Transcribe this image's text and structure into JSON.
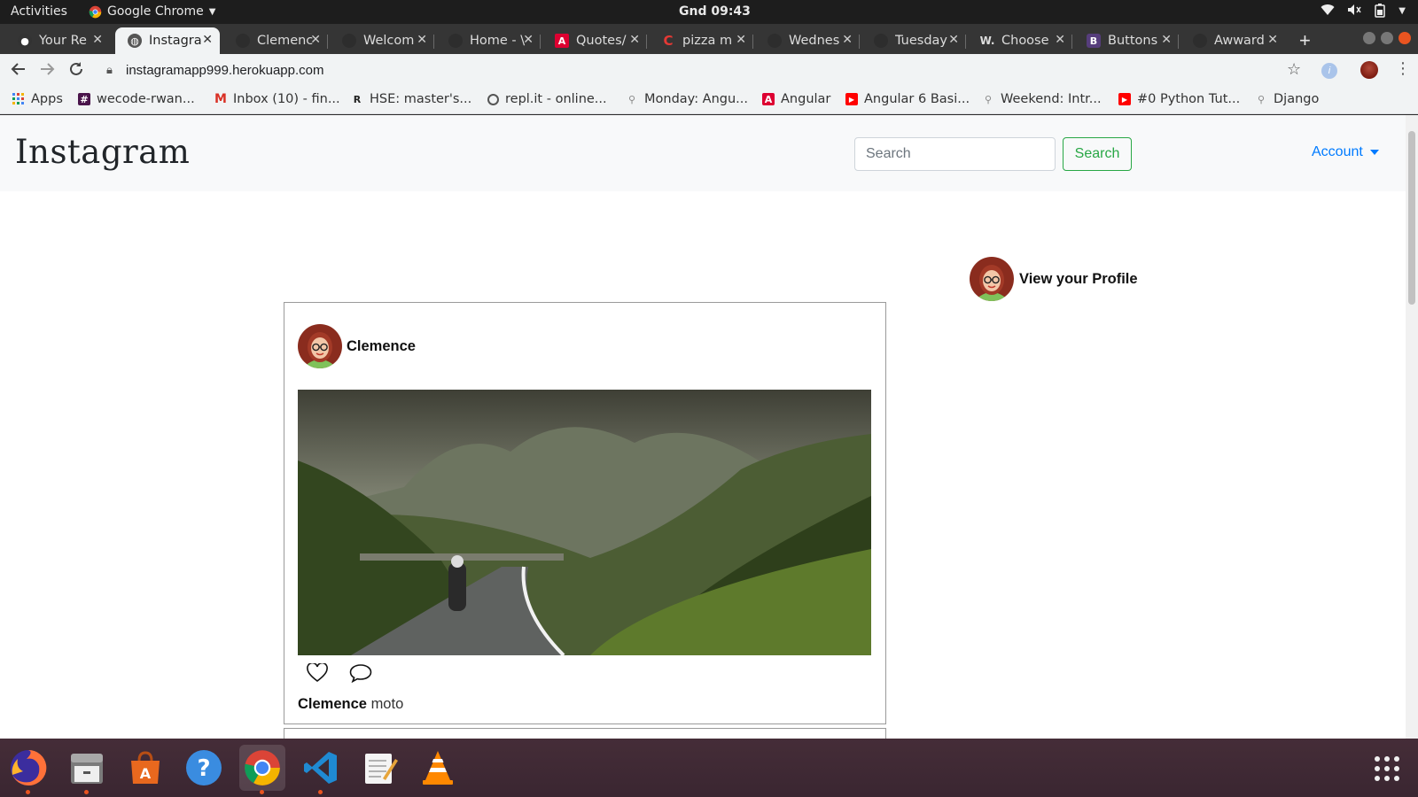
{
  "system": {
    "activities": "Activities",
    "app_name": "Google Chrome",
    "clock": "Gnd 09:43"
  },
  "tabs": [
    {
      "label": "Your Re",
      "icon": "github-icon",
      "color": "#333333"
    },
    {
      "label": "Instagra",
      "icon": "globe-icon",
      "color": "#555555",
      "active": true
    },
    {
      "label": "Clemenc",
      "icon": "github-icon",
      "color": "#333333"
    },
    {
      "label": "Welcom",
      "icon": "github-icon",
      "color": "#333333"
    },
    {
      "label": "Home - \\",
      "icon": "github-icon",
      "color": "#333333"
    },
    {
      "label": "Quotes/",
      "icon": "angular-icon",
      "color": "#dd0031"
    },
    {
      "label": "pizza m",
      "icon": "codepen-icon",
      "color": "#e53935"
    },
    {
      "label": "Wednes",
      "icon": "github-icon",
      "color": "#333333"
    },
    {
      "label": "Tuesday",
      "icon": "github-icon",
      "color": "#333333"
    },
    {
      "label": "Choose",
      "icon": "w3schools-icon",
      "color": "#222222"
    },
    {
      "label": "Buttons",
      "icon": "bootstrap-icon",
      "color": "#563d7c"
    },
    {
      "label": "Awward",
      "icon": "github-icon",
      "color": "#333333"
    }
  ],
  "address_bar": {
    "url": "instagramapp999.herokuapp.com"
  },
  "bookmarks": [
    {
      "label": "Apps",
      "icon": "apps-grid-icon",
      "color": "#4285f4"
    },
    {
      "label": "wecode-rwan...",
      "icon": "slack-icon",
      "color": "#4a154b"
    },
    {
      "label": "Inbox (10) - fin...",
      "icon": "gmail-icon",
      "color": "#d93025"
    },
    {
      "label": "HSE: master's...",
      "icon": "hse-icon",
      "color": "#222222"
    },
    {
      "label": "repl.it - online...",
      "icon": "replit-icon",
      "color": "#555555"
    },
    {
      "label": "Monday: Angu...",
      "icon": "pin-icon",
      "color": "#888888"
    },
    {
      "label": "Angular",
      "icon": "angular-icon",
      "color": "#dd0031"
    },
    {
      "label": "Angular 6 Basi...",
      "icon": "youtube-icon",
      "color": "#ff0000"
    },
    {
      "label": "Weekend: Intr...",
      "icon": "pin-icon",
      "color": "#888888"
    },
    {
      "label": "#0 Python Tut...",
      "icon": "youtube-icon",
      "color": "#ff0000"
    },
    {
      "label": "Django",
      "icon": "pin-icon",
      "color": "#888888"
    }
  ],
  "page": {
    "brand": "Instagram",
    "search_placeholder": "Search",
    "search_button": "Search",
    "account_label": "Account",
    "profile_link": "View your Profile",
    "post": {
      "username": "Clemence",
      "caption_user": "Clemence",
      "caption_text": "moto"
    }
  },
  "colors": {
    "accent_link": "#007bff",
    "accent_success": "#28a745",
    "ubuntu_orange": "#e95420"
  }
}
